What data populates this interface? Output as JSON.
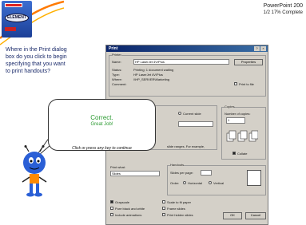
{
  "header": {
    "course_title": "PowerPoint 200",
    "progress": "1/2    17% Complete",
    "logo_text": "ELEMENT"
  },
  "lesson": {
    "question": "Where in the Print dialog box do you click to begin specifying that you want to print handouts?"
  },
  "feedback": {
    "correct": "Correct.",
    "great_job": "Great Job!",
    "continue_msg": "Click or press any key to continue"
  },
  "dialog": {
    "title": "Print",
    "printer_group": "Printer",
    "name_label": "Name:",
    "name_value": "HP LaserJet 4V/Plus",
    "properties_button": "Properties",
    "status_label": "Status:",
    "status_value": "Printing: 1 document waiting",
    "type_label": "Type:",
    "type_value": "HP LaserJet 4V/Plus",
    "where_label": "Where:",
    "where_value": "\\\\HP_SERVER\\Marketing",
    "comment_label": "Comment:",
    "print_to_file": "Print to file",
    "print_range_group": "Print range",
    "current_slide": "Current slide",
    "selection": "Selection",
    "copies_group": "Copies",
    "number_of_copies": "Number of copies:",
    "copies_value": "1",
    "collate": "Collate",
    "range_hint": "slide ranges. For example,",
    "print_what_label": "Print what:",
    "print_what_value": "Slides",
    "handouts_group": "Handouts",
    "slides_per_page_label": "Slides per page:",
    "order_label": "Order:",
    "horizontal": "Horizontal",
    "vertical": "Vertical",
    "grayscale": "Grayscale",
    "pure_black_white": "Pure black and white",
    "include_animations": "Include animations",
    "scale_to_fit": "Scale to fit paper",
    "frame_slides": "Frame slides",
    "print_hidden": "Print hidden slides",
    "ok_button": "OK",
    "cancel_button": "Cancel"
  },
  "colors": {
    "dialog_bg": "#d4d0c8",
    "title_bar": "#0a246a",
    "question_text": "#1a2a6a",
    "correct_text": "#2a9a30"
  }
}
